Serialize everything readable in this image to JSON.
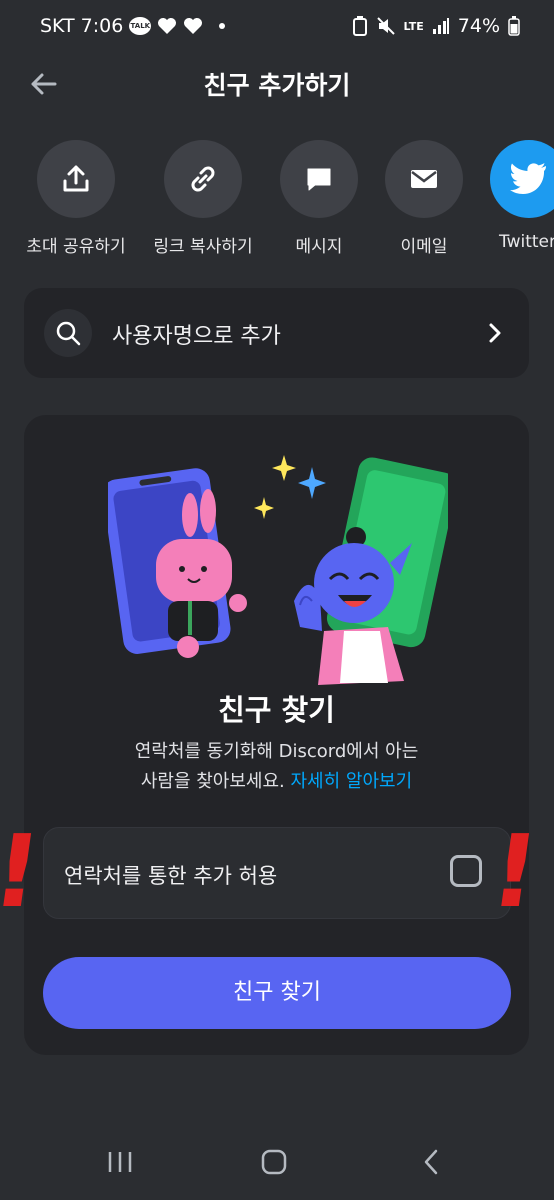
{
  "status_bar": {
    "carrier": "SKT",
    "time": "7:06",
    "talk_badge": "TALK",
    "network": "LTE",
    "battery": "74%"
  },
  "header": {
    "title": "친구 추가하기",
    "back_icon": "arrow-left-icon"
  },
  "share_options": [
    {
      "label": "초대 공유하기",
      "icon": "share-upload-icon"
    },
    {
      "label": "링크 복사하기",
      "icon": "link-icon"
    },
    {
      "label": "메시지",
      "icon": "chat-bubble-icon"
    },
    {
      "label": "이메일",
      "icon": "envelope-icon"
    },
    {
      "label": "Twitter",
      "icon": "twitter-bird-icon"
    }
  ],
  "username_search": {
    "label": "사용자명으로 추가"
  },
  "find_friends": {
    "title": "친구 찾기",
    "description_line1": "연락처를 동기화해 Discord에서 아는",
    "description_line2": "사람을 찾아보세요.",
    "learn_more_link": "자세히 알아보기",
    "contact_toggle_label": "연락처를 통한 추가 허용",
    "contact_toggle_checked": false,
    "button_label": "친구 찾기"
  },
  "annotations": {
    "left_mark": "!",
    "right_mark": "!"
  },
  "colors": {
    "background": "#2b2d31",
    "card": "#232428",
    "blurple": "#5865f2",
    "link": "#00a8fc",
    "twitter": "#1d9bf0",
    "annotation_red": "#e02020"
  }
}
